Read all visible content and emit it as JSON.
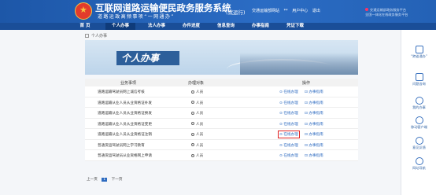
{
  "header": {
    "title": "互联网道路运输便民政务服务系统",
    "trial": "(试运行)",
    "slogan": "道路运政高频事项“一网通办”",
    "top_links": [
      "交通运输部网站",
      "**",
      "用户中心",
      "退出"
    ],
    "right_tag": [
      "交通运输部政务服务平台",
      "全国一体化在线政务服务平台"
    ]
  },
  "nav": {
    "items": [
      {
        "label": "首 页",
        "active": false
      },
      {
        "label": "个人办事",
        "active": true
      },
      {
        "label": "法人办事",
        "active": false
      },
      {
        "label": "办件进度",
        "active": false
      },
      {
        "label": "信息查询",
        "active": false
      },
      {
        "label": "办事指南",
        "active": false
      },
      {
        "label": "凭证下载",
        "active": false
      }
    ]
  },
  "breadcrumb": {
    "text": "个人办事"
  },
  "banner": {
    "text": "个人办事"
  },
  "table": {
    "headers": {
      "name": "业务事项",
      "object": "办理对象",
      "ops": "操作"
    },
    "rows": [
      {
        "name": "道路运输驾驶员网上诚信考核",
        "object": "人员",
        "op1": "在线办理",
        "op2": "办事指南",
        "highlight": false
      },
      {
        "name": "道路运输从业人员从业资格证补发",
        "object": "人员",
        "op1": "在线办理",
        "op2": "办事指南",
        "highlight": false
      },
      {
        "name": "道路运输从业人员从业资格证换发",
        "object": "人员",
        "op1": "在线办理",
        "op2": "办事指南",
        "highlight": false
      },
      {
        "name": "道路运输从业人员从业资格证变更",
        "object": "人员",
        "op1": "在线办理",
        "op2": "办事指南",
        "highlight": false
      },
      {
        "name": "道路运输从业人员从业资格证注销",
        "object": "人员",
        "op1": "在线办理",
        "op2": "办事指南",
        "highlight": true
      },
      {
        "name": "普通货运驾驶员网上学习教育",
        "object": "人员",
        "op1": "在线办理",
        "op2": "办事指南",
        "highlight": false
      },
      {
        "name": "普通货运驾驶员从业资格网上申请",
        "object": "人员",
        "op1": "在线办理",
        "op2": "办事指南",
        "highlight": false
      }
    ]
  },
  "pager": {
    "prev": "上一页",
    "current": "1",
    "next": "下一页"
  },
  "sidebar": {
    "items": [
      {
        "label": "“跨省通办”",
        "icon": "document-icon"
      },
      {
        "label": "问题咨询",
        "icon": "chat-icon"
      },
      {
        "label": "我的办事",
        "icon": "user-icon"
      },
      {
        "label": "移动客户端",
        "icon": "phone-icon"
      },
      {
        "label": "意见反馈",
        "icon": "question-icon"
      },
      {
        "label": "网站导航",
        "icon": "map-icon"
      }
    ]
  }
}
